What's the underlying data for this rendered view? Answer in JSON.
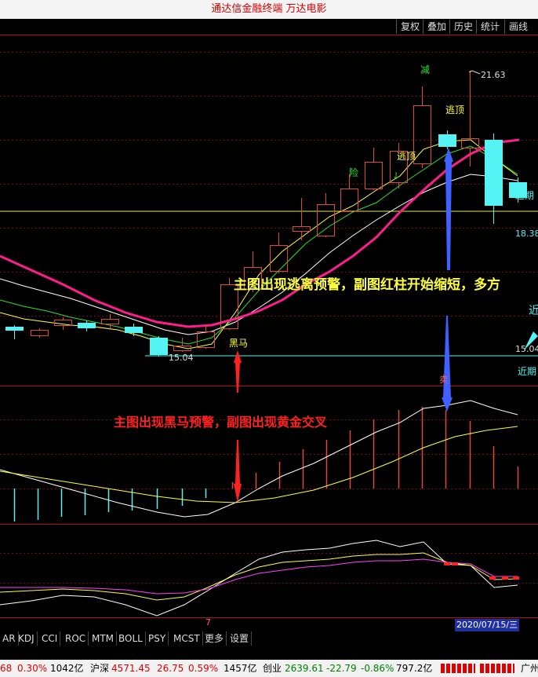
{
  "window": {
    "title": "通达信金融终端 万达电影"
  },
  "toolbar": {
    "buttons": [
      "复权",
      "叠加",
      "历史",
      "统计",
      "画线"
    ]
  },
  "main_chart": {
    "high_label": "21.63",
    "right_value_1": "18.38",
    "right_value_2": "15.04",
    "low_label": "15.04",
    "partial_label_1": "近期",
    "partial_label_2": "近期",
    "partial_label_3": "近",
    "signals": {
      "jian": "减",
      "taoding_1": "逃顶",
      "taoding_2": "逃顶",
      "xian": "险",
      "heima": "黑马",
      "sub_marker": "卖"
    }
  },
  "annotations": {
    "top": "主图出现逃离预警，副图红柱开始缩短，多方",
    "bottom": "主图出现黑马预警，副图出现黄金交叉"
  },
  "bottom_tabs": {
    "items": [
      "AR",
      "KDJ",
      "CCI",
      "ROC",
      "MTM",
      "BOLL",
      "PSY",
      "MCST",
      "更多",
      "设置"
    ],
    "page_marker": "7",
    "date": "2020/07/15/三"
  },
  "status_bar": {
    "idx1": {
      "value": "68",
      "pct": "0.30%",
      "amount": "1042亿"
    },
    "idx2": {
      "name": "沪深",
      "value": "4571.45",
      "change": "26.75",
      "pct": "0.59%",
      "amount": "1457亿"
    },
    "idx3": {
      "name": "创业",
      "value": "2639.61",
      "change": "-22.79",
      "pct": "-0.86%",
      "amount": "797.2亿"
    },
    "region": "广州"
  },
  "colors": {
    "up": "#e0483a",
    "down": "#54f4f4",
    "ma_pink": "#ff1c8c",
    "ma_yellow": "#ffff40",
    "ma_green": "#30e030",
    "ma_white": "#ffffff",
    "arrow_red": "#ff2020",
    "arrow_blue": "#4060ff",
    "status_red": "#e00000",
    "status_green": "#008000"
  }
}
